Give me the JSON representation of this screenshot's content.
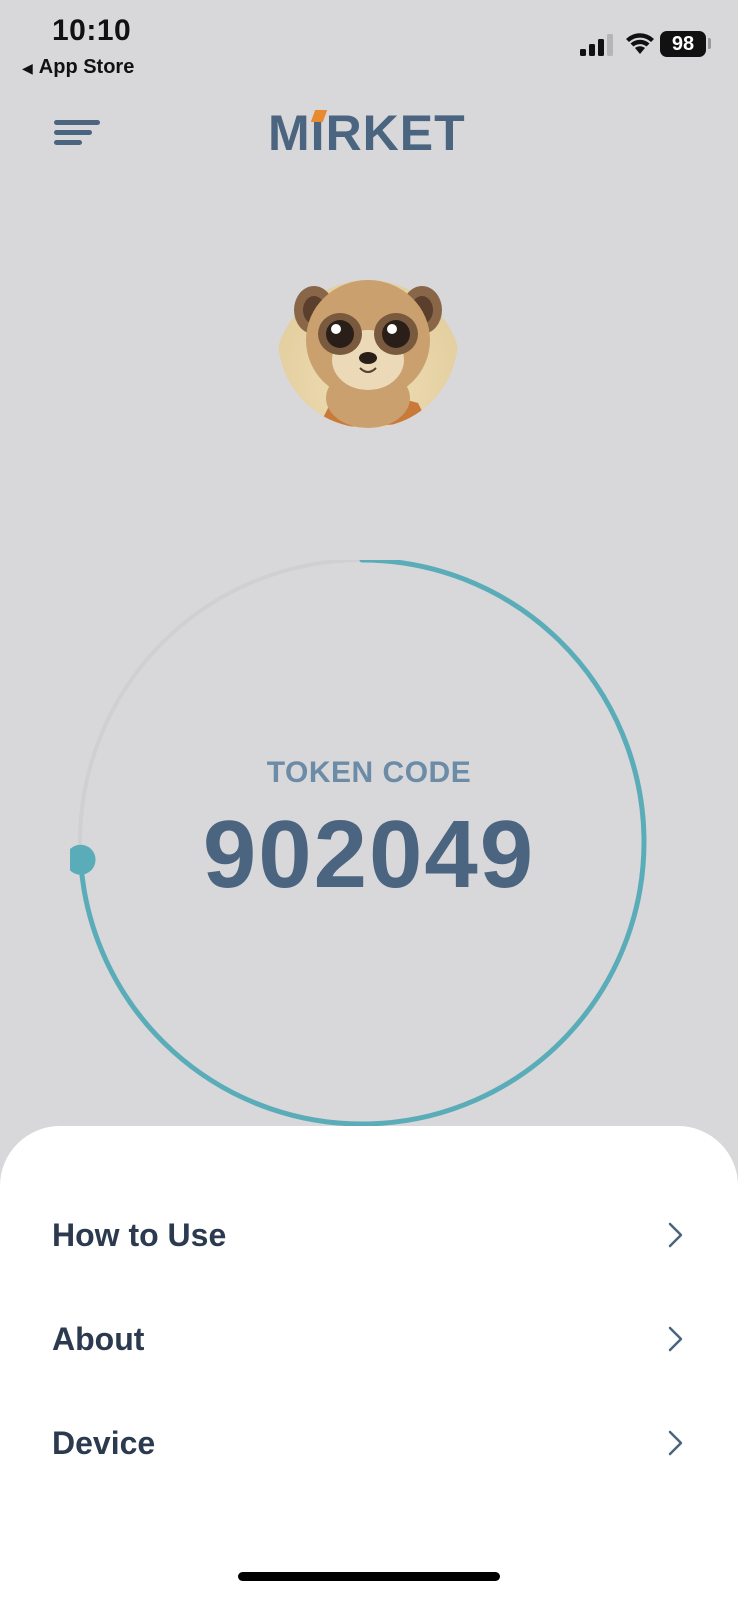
{
  "status_bar": {
    "time": "10:10",
    "back_app": "App Store",
    "battery": "98"
  },
  "header": {
    "brand_pre": "M",
    "brand_i": "I",
    "brand_post": "RKET"
  },
  "token": {
    "label": "TOKEN CODE",
    "code": "902049",
    "progress_fraction": 0.74
  },
  "menu": {
    "items": [
      {
        "label": "How to Use"
      },
      {
        "label": "About"
      },
      {
        "label": "Device"
      }
    ]
  },
  "colors": {
    "accent": "#5aadb8",
    "brand": "#4b6580",
    "brand_accent": "#e88a2e",
    "background": "#d8d8da",
    "sheet": "#ffffff"
  },
  "icons": [
    "back-triangle-icon",
    "signal-icon",
    "wifi-icon",
    "battery-icon",
    "hamburger-menu-icon",
    "chevron-right-icon"
  ]
}
